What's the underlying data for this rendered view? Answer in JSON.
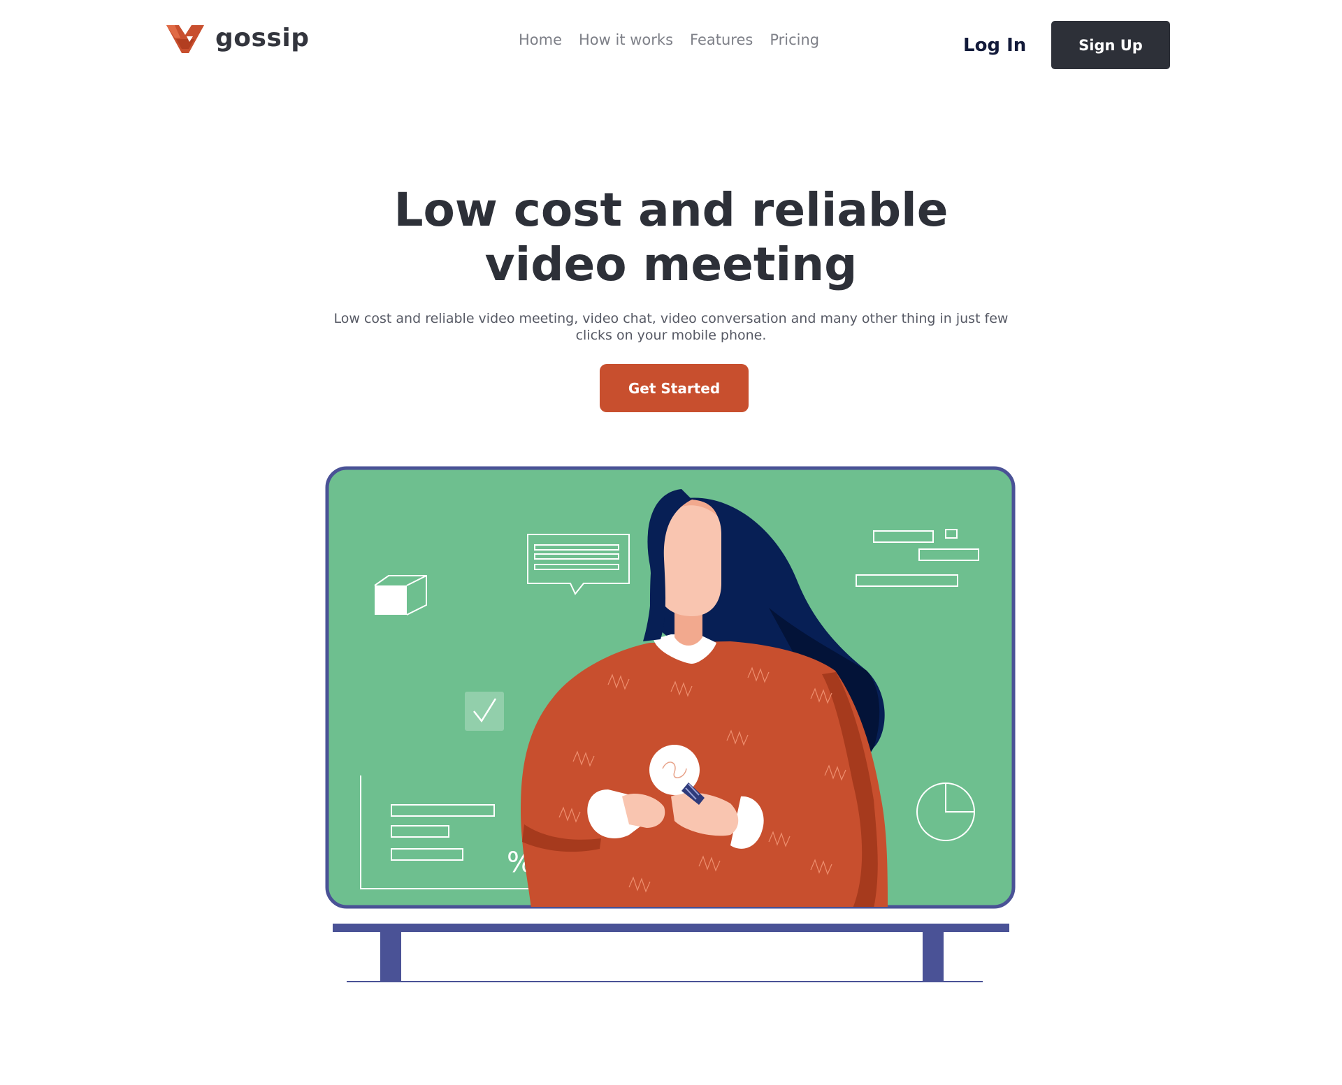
{
  "brand": {
    "name": "gossip",
    "logo_icon": "gossip-logo-icon",
    "accent_color": "#c84f2e"
  },
  "nav": {
    "items": [
      {
        "label": "Home"
      },
      {
        "label": "How it works"
      },
      {
        "label": "Features"
      },
      {
        "label": "Pricing"
      }
    ]
  },
  "header": {
    "login_label": "Log In",
    "signup_label": "Sign Up"
  },
  "hero": {
    "title": "Low cost and reliable video meeting",
    "subtitle": "Low cost and reliable video meeting, video chat, video conversation and many other thing in just few clicks on your mobile phone.",
    "cta_label": "Get Started"
  },
  "illustration": {
    "name": "video-meeting-illustration",
    "percent_symbol": "%",
    "colors": {
      "screen": "#6ebf8f",
      "frame": "#4a5296",
      "hair": "#071f55",
      "sweater": "#c84f2e",
      "skin": "#f9c5b0"
    }
  }
}
